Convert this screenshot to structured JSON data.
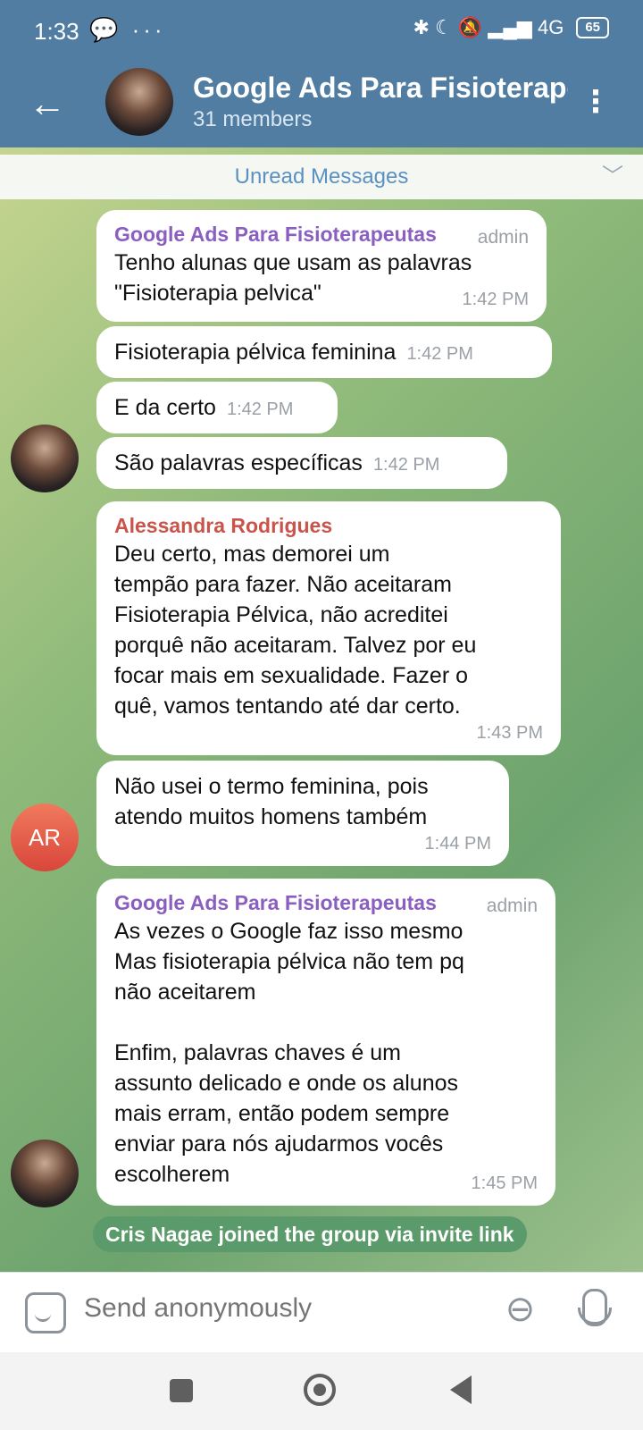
{
  "status_bar": {
    "time": "1:33",
    "left_icons": "💬 ···",
    "right_icons": "✱ ☾ 🔕 ▂▄▆ 4G",
    "battery": "65"
  },
  "header": {
    "title": "Google Ads Para Fisioterape",
    "subtitle": "31 members"
  },
  "unread_label": "Unread Messages",
  "messages": [
    {
      "sender": "Google Ads Para Fisioterapeutas",
      "badge": "admin",
      "text": "Tenho alunas que usam as palavras\n\"Fisioterapia pelvica\"",
      "time": "1:42 PM"
    },
    {
      "text": "Fisioterapia pélvica feminina",
      "time": "1:42 PM"
    },
    {
      "text": "E da certo",
      "time": "1:42 PM"
    },
    {
      "text": "São palavras específicas",
      "time": "1:42 PM"
    },
    {
      "sender": "Alessandra Rodrigues",
      "text": "Deu certo, mas demorei um\ntempão para fazer. Não aceitaram\nFisioterapia Pélvica, não acreditei\nporquê não aceitaram. Talvez por eu\nfocar mais em sexualidade. Fazer o\nquê, vamos tentando até dar certo.",
      "time": "1:43 PM"
    },
    {
      "text": "Não usei o termo feminina, pois\natendo muitos homens também",
      "time": "1:44 PM"
    },
    {
      "sender": "Google Ads Para Fisioterapeutas",
      "badge": "admin",
      "text": "As vezes o Google faz isso mesmo\nMas fisioterapia pélvica não tem pq\nnão aceitarem\n\nEnfim, palavras chaves é um\nassunto delicado e onde os alunos\nmais erram, então podem sempre\nenviar para nós ajudarmos vocês\nescolherem",
      "time": "1:45 PM"
    }
  ],
  "avatar_initials": "AR",
  "service_message": "Cris Nagae joined the group via invite link",
  "input": {
    "placeholder": "Send anonymously"
  },
  "colors": {
    "header": "#517da2",
    "admin_sender": "#8a5fbf",
    "member_sender": "#c8544b"
  }
}
